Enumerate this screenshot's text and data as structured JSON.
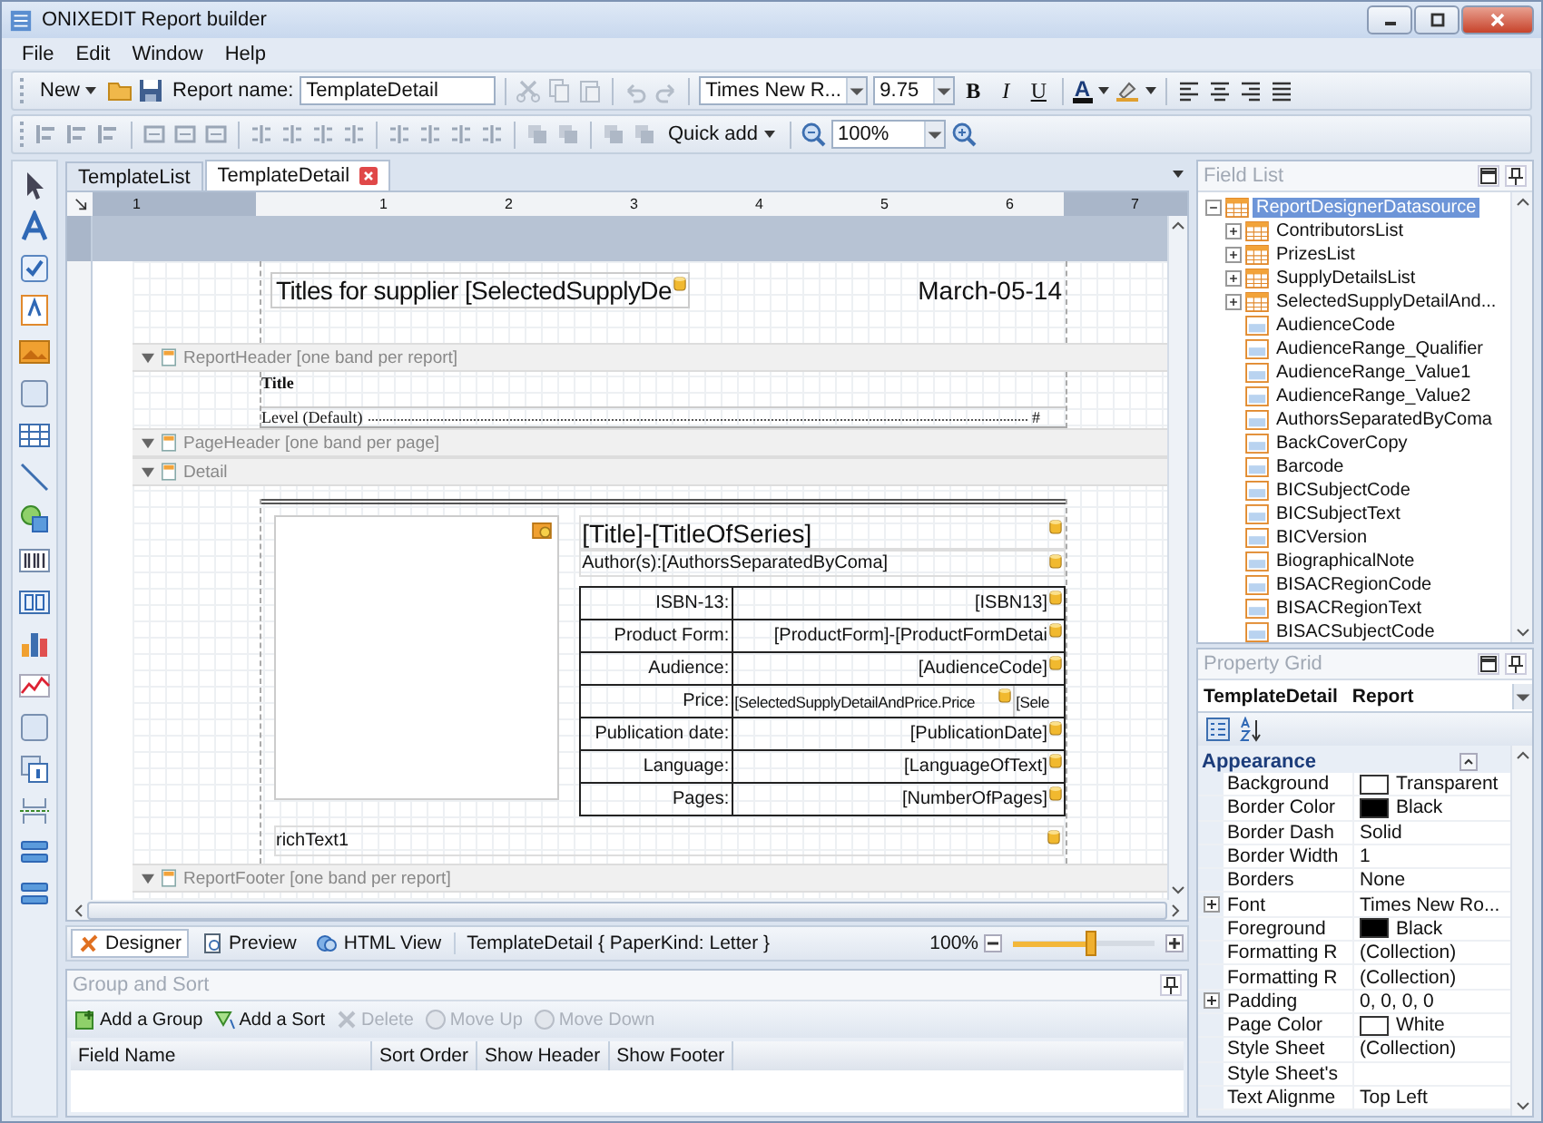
{
  "window": {
    "title": "ONIXEDIT Report builder"
  },
  "menu": [
    "File",
    "Edit",
    "Window",
    "Help"
  ],
  "toolbar": {
    "new": "New",
    "report_name_label": "Report name:",
    "report_name": "TemplateDetail",
    "font": "Times New R...",
    "size": "9.75",
    "bold": "B",
    "italic": "I",
    "underline": "U",
    "font_color": "A",
    "quick_add": "Quick add",
    "zoom": "100%"
  },
  "tabs": [
    {
      "label": "TemplateList",
      "selected": false,
      "closable": false
    },
    {
      "label": "TemplateDetail",
      "selected": true,
      "closable": true
    }
  ],
  "ruler": [
    "1",
    "1",
    "2",
    "3",
    "4",
    "5",
    "6",
    "7"
  ],
  "report": {
    "top_margin": {
      "title": "Titles for supplier [SelectedSupplyDe",
      "date": "March-05-14"
    },
    "report_header": {
      "band": "ReportHeader [one band per report]",
      "title": "Title",
      "level": "Level (Default)",
      "page_number": "#"
    },
    "page_header": {
      "band": "PageHeader [one band per page]"
    },
    "detail": {
      "band": "Detail",
      "title": "[Title]-[TitleOfSeries]",
      "authors": "Author(s):[AuthorsSeparatedByComa]",
      "rows": [
        {
          "label": "ISBN-13:",
          "values": [
            "[ISBN13]"
          ]
        },
        {
          "label": "Product Form:",
          "values": [
            "[ProductForm]-[ProductFormDetai"
          ]
        },
        {
          "label": "Audience:",
          "values": [
            "[AudienceCode]"
          ]
        },
        {
          "label": "Price:",
          "values": [
            "[SelectedSupplyDetailAndPrice.Price",
            "[Sele"
          ]
        },
        {
          "label": "Publication date:",
          "values": [
            "[PublicationDate]"
          ]
        },
        {
          "label": "Language:",
          "values": [
            "[LanguageOfText]"
          ]
        },
        {
          "label": "Pages:",
          "values": [
            "[NumberOfPages]"
          ]
        }
      ],
      "rich_text": "richText1"
    },
    "report_footer": {
      "band": "ReportFooter [one band per report]"
    }
  },
  "bottom_bar": {
    "views": [
      {
        "label": "Designer",
        "selected": true
      },
      {
        "label": "Preview",
        "selected": false
      },
      {
        "label": "HTML View",
        "selected": false
      }
    ],
    "status": "TemplateDetail { PaperKind: Letter }",
    "zoom": "100%",
    "level": 0.55
  },
  "group_and_sort": {
    "title": "Group and Sort",
    "actions": [
      {
        "label": "Add a Group",
        "disabled": false
      },
      {
        "label": "Add a Sort",
        "disabled": false
      },
      {
        "label": "Delete",
        "disabled": true
      },
      {
        "label": "Move Up",
        "disabled": true
      },
      {
        "label": "Move Down",
        "disabled": true
      }
    ],
    "columns": [
      "Field Name",
      "Sort Order",
      "Show Header",
      "Show Footer"
    ]
  },
  "field_list": {
    "title": "Field List",
    "root": {
      "label": "ReportDesignerDatasource",
      "kind": "datasource",
      "expanded": true,
      "selected": true,
      "children": [
        {
          "label": "ContributorsList",
          "kind": "table",
          "expanded": false,
          "selected": false
        },
        {
          "label": "PrizesList",
          "kind": "table",
          "expanded": false,
          "selected": false
        },
        {
          "label": "SupplyDetailsList",
          "kind": "table",
          "expanded": false,
          "selected": false
        },
        {
          "label": "SelectedSupplyDetailAnd...",
          "kind": "table",
          "expanded": false,
          "selected": false
        },
        {
          "label": "AudienceCode",
          "kind": "field",
          "selected": false
        },
        {
          "label": "AudienceRange_Qualifier",
          "kind": "field",
          "selected": false
        },
        {
          "label": "AudienceRange_Value1",
          "kind": "field",
          "selected": false
        },
        {
          "label": "AudienceRange_Value2",
          "kind": "field",
          "selected": false
        },
        {
          "label": "AuthorsSeparatedByComa",
          "kind": "field",
          "selected": false
        },
        {
          "label": "BackCoverCopy",
          "kind": "field",
          "selected": false
        },
        {
          "label": "Barcode",
          "kind": "field",
          "selected": false
        },
        {
          "label": "BICSubjectCode",
          "kind": "field",
          "selected": false
        },
        {
          "label": "BICSubjectText",
          "kind": "field",
          "selected": false
        },
        {
          "label": "BICVersion",
          "kind": "field",
          "selected": false
        },
        {
          "label": "BiographicalNote",
          "kind": "field",
          "selected": false
        },
        {
          "label": "BISACRegionCode",
          "kind": "field",
          "selected": false
        },
        {
          "label": "BISACRegionText",
          "kind": "field",
          "selected": false
        },
        {
          "label": "BISACSubjectCode",
          "kind": "field",
          "selected": false
        }
      ]
    }
  },
  "property_grid": {
    "title": "Property Grid",
    "object": "TemplateDetail",
    "object_type": "Report",
    "category": "Appearance",
    "properties": [
      {
        "name": "Background",
        "value": "Transparent",
        "color": "#ffffff",
        "expandable": false
      },
      {
        "name": "Border Color",
        "value": "Black",
        "color": "#000000",
        "expandable": false
      },
      {
        "name": "Border Dash",
        "value": "Solid",
        "expandable": false
      },
      {
        "name": "Border Width",
        "value": "1",
        "expandable": false
      },
      {
        "name": "Borders",
        "value": "None",
        "expandable": false
      },
      {
        "name": "Font",
        "value": "Times New Ro...",
        "expandable": true
      },
      {
        "name": "Foreground",
        "value": "Black",
        "color": "#000000",
        "expandable": false
      },
      {
        "name": "Formatting R",
        "value": "(Collection)",
        "expandable": false
      },
      {
        "name": "Formatting R",
        "value": "(Collection)",
        "expandable": false
      },
      {
        "name": "Padding",
        "value": "0, 0, 0, 0",
        "expandable": true
      },
      {
        "name": "Page Color",
        "value": "White",
        "color": "#ffffff",
        "expandable": false
      },
      {
        "name": "Style Sheet",
        "value": "(Collection)",
        "expandable": false
      },
      {
        "name": "Style Sheet's",
        "expandable": false
      },
      {
        "name": "Text Alignme",
        "value": "Top Left",
        "expandable": false
      }
    ]
  }
}
